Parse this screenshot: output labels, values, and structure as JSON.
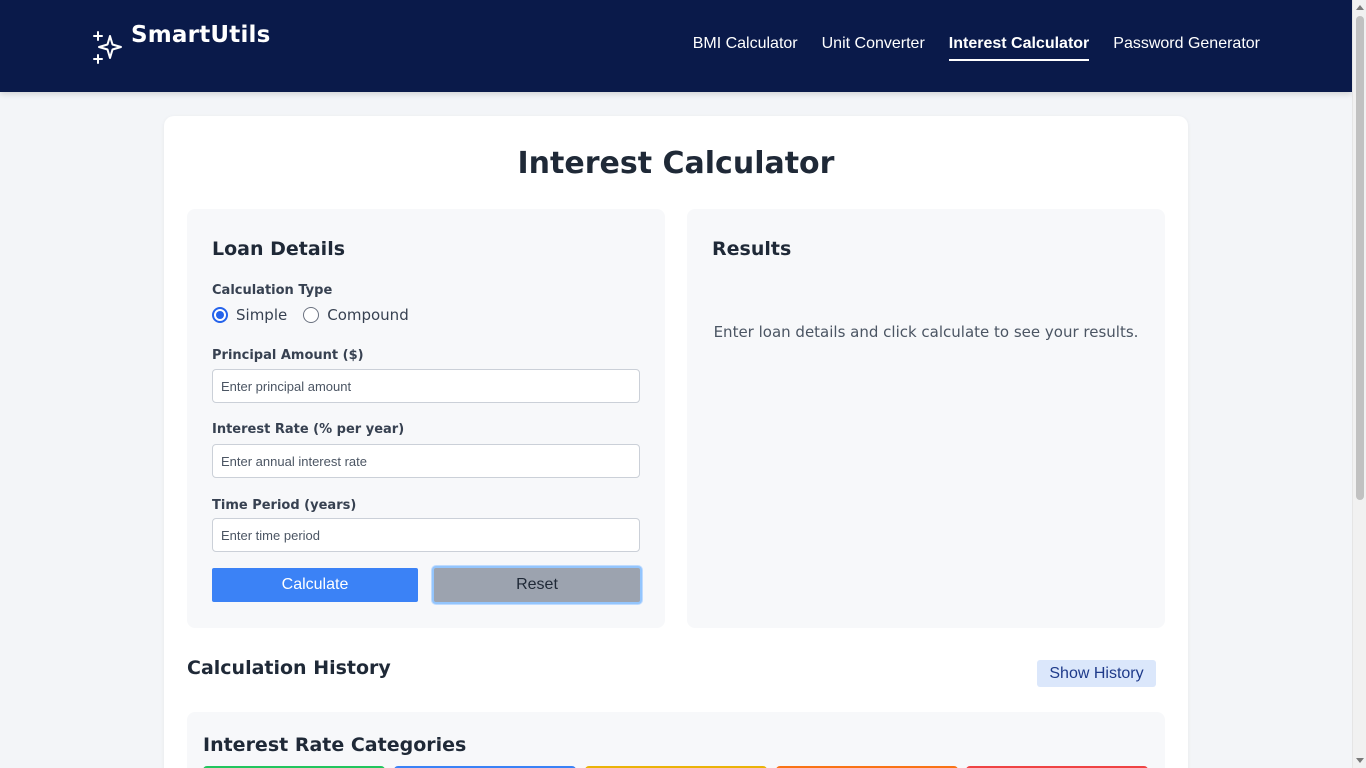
{
  "brand": {
    "name": "SmartUtils",
    "icon": "sparkles-icon"
  },
  "nav": {
    "items": [
      {
        "label": "BMI Calculator",
        "active": false
      },
      {
        "label": "Unit Converter",
        "active": false
      },
      {
        "label": "Interest Calculator",
        "active": true
      },
      {
        "label": "Password Generator",
        "active": false
      }
    ]
  },
  "page": {
    "title": "Interest Calculator"
  },
  "loan_details": {
    "heading": "Loan Details",
    "calculation_type": {
      "label": "Calculation Type",
      "options": [
        {
          "label": "Simple",
          "checked": true
        },
        {
          "label": "Compound",
          "checked": false
        }
      ]
    },
    "principal": {
      "label": "Principal Amount ($)",
      "placeholder": "Enter principal amount",
      "value": ""
    },
    "rate": {
      "label": "Interest Rate (% per year)",
      "placeholder": "Enter annual interest rate",
      "value": ""
    },
    "time": {
      "label": "Time Period (years)",
      "placeholder": "Enter time period",
      "value": ""
    },
    "calculate_label": "Calculate",
    "reset_label": "Reset"
  },
  "results": {
    "heading": "Results",
    "empty_message": "Enter loan details and click calculate to see your results."
  },
  "history": {
    "heading": "Calculation History",
    "toggle_label": "Show History"
  },
  "categories": {
    "heading": "Interest Rate Categories",
    "tile_colors": [
      "#22c55e",
      "#3b82f6",
      "#eab308",
      "#f97316",
      "#ef4444"
    ]
  },
  "colors": {
    "navbar": "#0a1a4a",
    "primary": "#3b82f6",
    "reset": "#9ca3af"
  }
}
